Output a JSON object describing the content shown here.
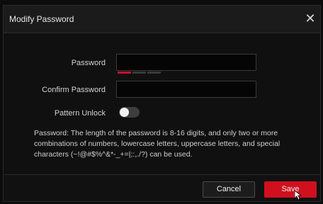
{
  "dialog": {
    "title": "Modify Password",
    "close_icon": "close-icon"
  },
  "form": {
    "password_label": "Password",
    "password_value": "",
    "confirm_label": "Confirm Password",
    "confirm_value": "",
    "pattern_label": "Pattern Unlock",
    "pattern_unlock_on": false,
    "strength_level_segments": 1,
    "strength_total_segments": 3
  },
  "hint": "Password: The length of the password is 8-16 digits, and only two or more combinations of numbers, lowercase letters, uppercase letters, and special characters (~!@#$%^&*-_+=|;:,./?) can be used.",
  "buttons": {
    "cancel_label": "Cancel",
    "save_label": "Save"
  },
  "colors": {
    "accent": "#d0101f",
    "background": "#101010"
  }
}
